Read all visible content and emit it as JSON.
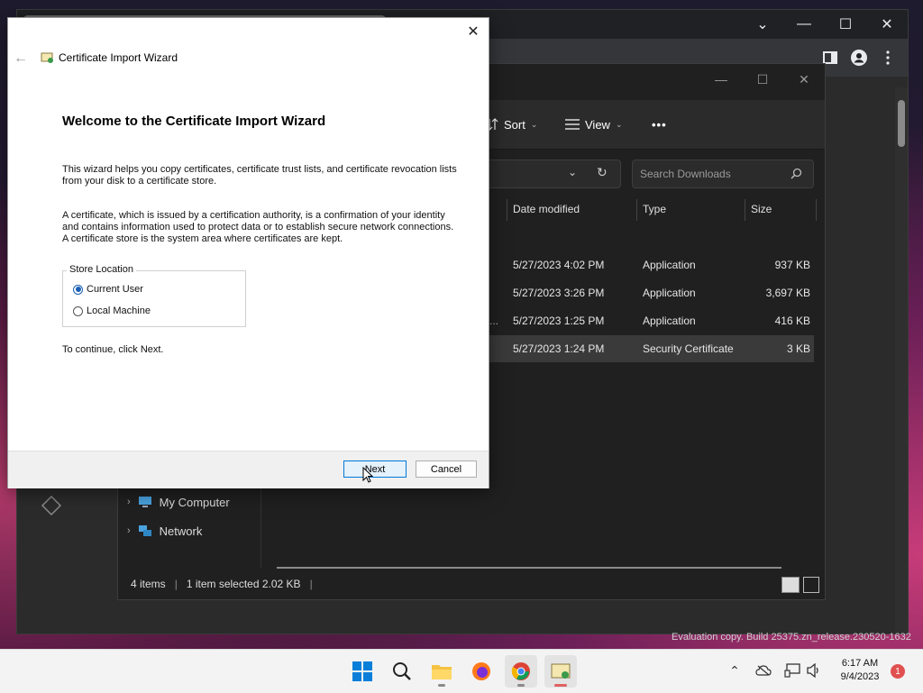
{
  "chrome": {
    "controls": {
      "dropdown": "⌄",
      "minimize": "—",
      "maximize": "☐",
      "close": "✕"
    }
  },
  "explorer": {
    "sort_label": "Sort",
    "view_label": "View",
    "more_label": "•••",
    "search_placeholder": "Search Downloads",
    "columns": {
      "date": "Date modified",
      "type": "Type",
      "size": "Size"
    },
    "rows": [
      {
        "name": "",
        "date": "5/27/2023 4:02 PM",
        "type": "Application",
        "size": "937 KB"
      },
      {
        "name": "",
        "date": "5/27/2023 3:26 PM",
        "type": "Application",
        "size": "3,697 KB"
      },
      {
        "name": "...",
        "date": "5/27/2023 1:25 PM",
        "type": "Application",
        "size": "416 KB"
      },
      {
        "name": "",
        "date": "5/27/2023 1:24 PM",
        "type": "Security Certificate",
        "size": "3 KB"
      }
    ],
    "nav": {
      "my_computer": "My Computer",
      "network": "Network"
    },
    "status": {
      "items": "4 items",
      "selected": "1 item selected  2.02 KB"
    }
  },
  "dialog": {
    "title": "Certificate Import Wizard",
    "heading": "Welcome to the Certificate Import Wizard",
    "para1": "This wizard helps you copy certificates, certificate trust lists, and certificate revocation lists from your disk to a certificate store.",
    "para2": "A certificate, which is issued by a certification authority, is a confirmation of your identity and contains information used to protect data or to establish secure network connections. A certificate store is the system area where certificates are kept.",
    "store_location_label": "Store Location",
    "options": {
      "current_user": "Current User",
      "local_machine": "Local Machine"
    },
    "selected_option": "current_user",
    "continue_text": "To continue, click Next.",
    "next_label": "Next",
    "cancel_label": "Cancel"
  },
  "taskbar": {
    "time": "6:17 AM",
    "date": "9/4/2023",
    "notification_count": "1"
  },
  "watermark": "Evaluation copy. Build 25375.zn_release.230520-1632",
  "colors": {
    "accent": "#0078d7",
    "explorer_bg": "#202020",
    "taskbar_bg": "#f3f3f3"
  }
}
